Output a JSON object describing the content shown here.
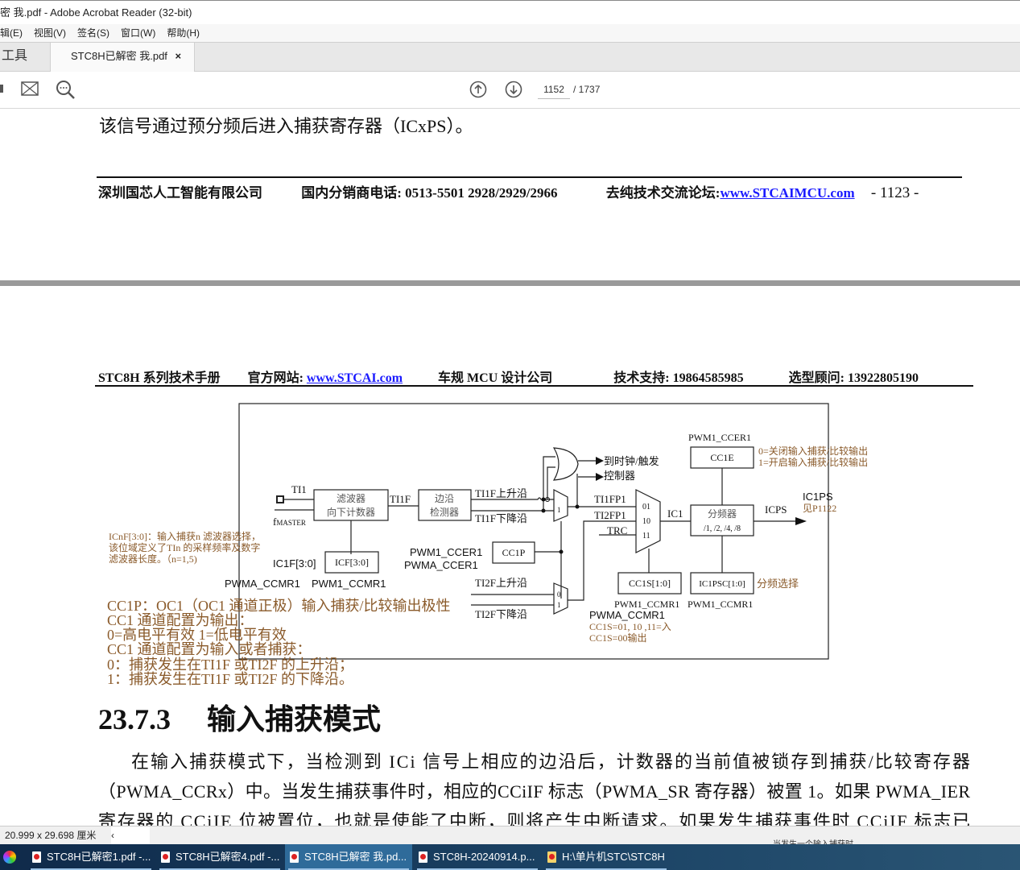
{
  "window": {
    "title": "密 我.pdf - Adobe Acrobat Reader (32-bit)",
    "title_prefix": "已解"
  },
  "menu": [
    "辑(E)",
    "视图(V)",
    "签名(S)",
    "窗口(W)",
    "帮助(H)"
  ],
  "tabs": {
    "tools": "工具",
    "doc": "STC8H已解密  我.pdf",
    "close": "×"
  },
  "toolbar": {
    "page_current": "1152",
    "page_total": "/ 1737"
  },
  "page1": {
    "body_tail": "该信号通过预分频后进入捕获寄存器（ICxPS）。",
    "footer_company": "深圳国芯人工智能有限公司",
    "footer_phone": "国内分销商电话: 0513-5501 2928/2929/2966",
    "footer_forum_label": "去纯技术交流论坛:",
    "footer_forum_link": "www.STCAIMCU.com",
    "footer_page": "- 1123 -"
  },
  "page2": {
    "header_manual": "STC8H 系列技术手册",
    "header_site_label": "官方网站: ",
    "header_site_link": "www.STCAI.com",
    "header_company": "车规 MCU 设计公司",
    "header_support": "技术支持: 19864585985",
    "header_consult": "选型顾问: 13922805190",
    "diagram": {
      "ti1": "TI1",
      "fmaster": "f",
      "fmaster_sub": "MASTER",
      "filter1": "滤波器",
      "filter2": "向下计数器",
      "ti1f": "TI1F",
      "edge1": "边沿",
      "edge2": "检测器",
      "ti1f_rise": "TI1F上升沿",
      "ti1f_fall": "TI1F下降沿",
      "icf_label": "IC1F[3:0]",
      "icf_box": "ICF[3:0]",
      "ccmr_a": "PWMA_CCMR1",
      "ccmr_1": "PWM1_CCMR1",
      "icnf1": "ICnF[3:0]：输入捕获n 滤波器选择，",
      "icnf2": "该位域定义了TIn 的采样频率及数字",
      "icnf3": "滤波器长度。（n=1,5)",
      "ccer1": "PWM1_CCER1",
      "ccera": "PWMA_CCER1",
      "cc1p": "CC1P",
      "ti2f_rise": "TI2F上升沿",
      "ti2f_fall": "TI2F下降沿",
      "mux1_1": "1",
      "mux2_0": "0",
      "mux2_1": "1",
      "to_clock1": "到时钟/触发",
      "to_clock2": "控制器",
      "ti1fp1": "TI1FP1",
      "ti2fp1": "TI2FP1",
      "trc": "TRC",
      "m01": "01",
      "m10": "10",
      "m11": "11",
      "ic1": "IC1",
      "cc1s_box": "CC1S[1:0]",
      "ccmr_1b": "PWM1_CCMR1",
      "ccmr_ab": "PWMA_CCMR1",
      "cc1s_note1": "CC1S=01, 10 ,11=入",
      "cc1s_note2": "CC1S=00输出",
      "ccer_top": "PWM1_CCER1",
      "cc1e": "CC1E",
      "cc1e_note0": "0=关闭输入捕获/比较输出",
      "cc1e_note1": "1=开启输入捕获/比较输出",
      "div1": "分频器",
      "div2": "/1, /2, /4, /8",
      "icps": "ICPS",
      "ic1ps": "IC1PS",
      "see": "见P1122",
      "ic1psc_box": "IC1PSC[1:0]",
      "ic1psc_reg": "PWM1_CCMR1",
      "div_sel": "分频选择"
    },
    "cc1p_notes": [
      "CC1P：OC1（OC1 通道正极）输入捕获/比较输出极性",
      "CC1 通道配置为输出：",
      "0=高电平有效   1=低电平有效",
      "CC1 通道配置为输入或者捕获：",
      "0：捕获发生在TI1F 或TI2F 的上升沿；",
      "1：捕获发生在TI1F 或TI2F 的下降沿。"
    ],
    "section_number": "23.7.3",
    "section_title": "输入捕获模式",
    "para": [
      "在输入捕获模式下，当检测到 ICi 信号上相应的边沿后，计数器的当前值被锁存到捕获/比较寄存器",
      "（PWMA_CCRx）中。当发生捕获事件时，相应的CCiIF 标志（PWMA_SR 寄存器）被置 1。如果 PWMA_IER",
      "寄存器的 CCiIE 位被置位，也就是使能了中断，则将产生中断请求。如果发生捕获事件时 CCiIF 标志已"
    ]
  },
  "status": {
    "page_size": "20.999 x 29.698 厘米",
    "chevron": "‹",
    "peek": "当发生一个输入捕获时,"
  },
  "taskbar": [
    "STC8H已解密1.pdf -...",
    "STC8H已解密4.pdf -...",
    "STC8H已解密  我.pd...",
    "STC8H-20240914.p...",
    "H:\\单片机STC\\STC8H"
  ],
  "colors": {
    "link": "#1a1aff",
    "annotation": "#8a5a2a",
    "taskbar": "#1c4466"
  }
}
